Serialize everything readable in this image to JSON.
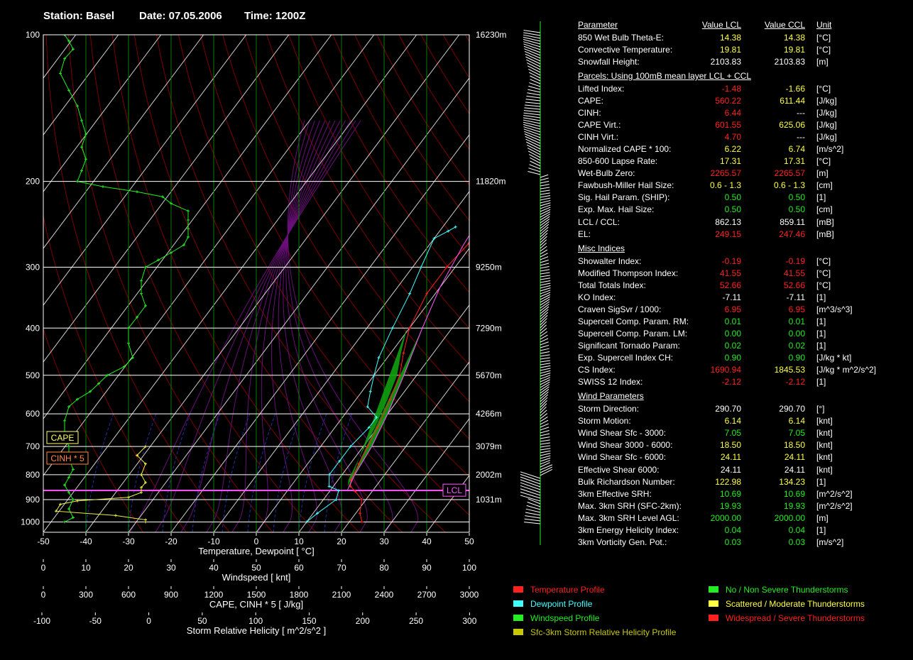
{
  "header": {
    "station": "Station: Basel",
    "date": "Date: 07.05.2006",
    "time": "Time: 1200Z"
  },
  "colors": {
    "temperature": "#ff2020",
    "dewpoint": "#40ffff",
    "windspeed": "#22ee22",
    "srh": "#eeee44",
    "parcel": "#ff55ff",
    "cape_fill": "#10a010",
    "green": "#22ee22",
    "yellow": "#ffff44",
    "red": "#ff2020",
    "white": "#ffffff"
  },
  "chart_data": {
    "type": "line",
    "title": "Skew-T log-P sounding",
    "pressure_levels": [
      100,
      200,
      300,
      400,
      500,
      600,
      700,
      800,
      900,
      1000
    ],
    "height_labels": [
      {
        "p": 100,
        "label": "16230m"
      },
      {
        "p": 200,
        "label": "11820m"
      },
      {
        "p": 300,
        "label": "9250m"
      },
      {
        "p": 400,
        "label": "7290m"
      },
      {
        "p": 500,
        "label": "5670m"
      },
      {
        "p": 600,
        "label": "4266m"
      },
      {
        "p": 700,
        "label": "3079m"
      },
      {
        "p": 800,
        "label": "2002m"
      },
      {
        "p": 900,
        "label": "1031m"
      }
    ],
    "axes": [
      {
        "label": "Temperature, Dewpoint  [ °C]",
        "ticks": [
          "-50",
          "-40",
          "-30",
          "-20",
          "-10",
          "0",
          "10",
          "20",
          "30",
          "40",
          "50"
        ]
      },
      {
        "label": "Windspeed  [ knt]",
        "ticks": [
          "0",
          "10",
          "20",
          "30",
          "40",
          "50",
          "60",
          "70",
          "80",
          "90",
          "100"
        ]
      },
      {
        "label": "CAPE, CINH * 5  [ J/kg]",
        "ticks": [
          "0",
          "300",
          "600",
          "900",
          "1200",
          "1500",
          "1800",
          "2100",
          "2400",
          "2700",
          "3000"
        ]
      },
      {
        "label": "Storm Relative Helicity  [ m^2/s^2 ]",
        "ticks": [
          "-100",
          "-50",
          "0",
          "50",
          "100",
          "150",
          "200",
          "250",
          "300"
        ]
      }
    ],
    "xlim": [
      -50,
      50
    ],
    "plim": [
      100,
      1050
    ],
    "boxes": {
      "cape": "CAPE",
      "cinh": "CINH * 5",
      "lcl": "LCL"
    },
    "lcl_pressure": 862,
    "temperature": [
      [
        -2,
        248
      ],
      [
        -1,
        243
      ],
      [
        0,
        237
      ],
      [
        1,
        230
      ],
      [
        2,
        224
      ],
      [
        4,
        213
      ],
      [
        7,
        205
      ],
      [
        10,
        200
      ],
      [
        13,
        193
      ],
      [
        17,
        185
      ],
      [
        21,
        176
      ],
      [
        25,
        167
      ],
      [
        30,
        158
      ],
      [
        33,
        150
      ],
      [
        36,
        142
      ],
      [
        40,
        134
      ],
      [
        44,
        126
      ],
      [
        48,
        119
      ],
      [
        51,
        113
      ],
      [
        54,
        108
      ],
      [
        57,
        103
      ],
      [
        -1,
        268
      ],
      [
        -2,
        300
      ],
      [
        -2,
        340
      ],
      [
        0,
        400
      ],
      [
        3,
        450
      ],
      [
        6,
        500
      ],
      [
        8,
        560
      ],
      [
        10,
        640
      ],
      [
        11,
        700
      ],
      [
        12,
        760
      ],
      [
        13,
        820
      ],
      [
        14,
        845
      ],
      [
        16,
        865
      ],
      [
        19,
        900
      ],
      [
        21,
        960
      ],
      [
        23,
        1000
      ]
    ],
    "dewpoint": [
      [
        -7,
        248
      ],
      [
        -8,
        253
      ],
      [
        -10,
        262
      ],
      [
        -8,
        300
      ],
      [
        -6,
        340
      ],
      [
        -4,
        400
      ],
      [
        -2,
        460
      ],
      [
        0,
        500
      ],
      [
        2,
        540
      ],
      [
        4,
        580
      ],
      [
        8,
        610
      ],
      [
        8,
        640
      ],
      [
        7,
        700
      ],
      [
        7,
        750
      ],
      [
        7,
        800
      ],
      [
        9,
        845
      ],
      [
        12,
        862
      ],
      [
        13,
        900
      ],
      [
        11,
        960
      ],
      [
        10,
        1000
      ]
    ],
    "dewpoint_upper": [
      [
        -2,
        238
      ],
      [
        0,
        224
      ],
      [
        2,
        212
      ],
      [
        5,
        200
      ]
    ],
    "parcel": [
      [
        14,
        862
      ],
      [
        13,
        800
      ],
      [
        12,
        700
      ],
      [
        10,
        600
      ],
      [
        7,
        500
      ],
      [
        3,
        400
      ],
      [
        0,
        330
      ],
      [
        -2,
        270
      ],
      [
        -3,
        230
      ],
      [
        -3,
        200
      ],
      [
        -3,
        170
      ],
      [
        -2,
        150
      ],
      [
        -1,
        130
      ],
      [
        0,
        115
      ],
      [
        2,
        100
      ]
    ],
    "windspeed": [
      [
        5,
        100
      ],
      [
        6,
        103
      ],
      [
        7,
        107
      ],
      [
        5,
        112
      ],
      [
        4,
        120
      ],
      [
        6,
        130
      ],
      [
        8,
        140
      ],
      [
        9,
        150
      ],
      [
        10,
        160
      ],
      [
        9,
        170
      ],
      [
        10,
        180
      ],
      [
        9,
        190
      ],
      [
        8,
        200
      ],
      [
        14,
        205
      ],
      [
        22,
        210
      ],
      [
        28,
        215
      ],
      [
        30,
        222
      ],
      [
        34,
        230
      ],
      [
        34,
        240
      ],
      [
        34,
        250
      ],
      [
        34,
        260
      ],
      [
        33,
        270
      ],
      [
        30,
        280
      ],
      [
        27,
        290
      ],
      [
        24,
        300
      ],
      [
        23,
        320
      ],
      [
        23,
        340
      ],
      [
        24,
        360
      ],
      [
        22,
        380
      ],
      [
        20,
        400
      ],
      [
        20,
        430
      ],
      [
        21,
        460
      ],
      [
        19,
        480
      ],
      [
        15,
        500
      ],
      [
        13,
        520
      ],
      [
        11,
        540
      ],
      [
        8,
        560
      ],
      [
        6,
        580
      ],
      [
        5,
        620
      ],
      [
        5,
        660
      ],
      [
        6,
        700
      ],
      [
        6,
        740
      ],
      [
        7,
        780
      ],
      [
        6,
        810
      ],
      [
        5,
        840
      ],
      [
        6,
        870
      ],
      [
        7,
        900
      ],
      [
        6,
        940
      ],
      [
        7,
        980
      ],
      [
        5,
        1000
      ]
    ],
    "srh": [
      [
        24,
        700
      ],
      [
        22,
        730
      ],
      [
        24,
        760
      ],
      [
        23,
        800
      ],
      [
        24,
        830
      ],
      [
        23,
        850
      ],
      [
        23,
        870
      ],
      [
        20,
        890
      ],
      [
        8,
        905
      ],
      [
        4,
        920
      ],
      [
        3,
        950
      ],
      [
        17,
        970
      ],
      [
        24,
        990
      ],
      [
        24,
        1000
      ]
    ]
  },
  "params": {
    "rows": [
      {
        "name": "Parameter",
        "v1": "Value LCL",
        "v2": "Value CCL",
        "unit": "Unit",
        "header": true
      },
      {
        "name": "850 Wet Bulb Theta-E:",
        "v1": "14.38",
        "v2": "14.38",
        "unit": "[°C]",
        "c1": "#ffff44",
        "c2": "#ffff44"
      },
      {
        "name": "Convective Temperature:",
        "v1": "19.81",
        "v2": "19.81",
        "unit": "[°C]",
        "c1": "#ffff44",
        "c2": "#ffff44"
      },
      {
        "name": "Snowfall Height:",
        "v1": "2103.83",
        "v2": "2103.83",
        "unit": "[m]",
        "c1": "#ffffff",
        "c2": "#ffffff"
      },
      {
        "name": "Parcels: Using 100mB mean layer LCL + CCL",
        "v1": "",
        "v2": "",
        "unit": "",
        "section": true
      },
      {
        "name": "Lifted Index:",
        "v1": "-1.48",
        "v2": "-1.66",
        "unit": "[°C]",
        "c1": "#ff2020",
        "c2": "#ffff44"
      },
      {
        "name": "CAPE:",
        "v1": "560.22",
        "v2": "611.44",
        "unit": "[J/kg]",
        "c1": "#ff2020",
        "c2": "#ffff44"
      },
      {
        "name": "CINH:",
        "v1": "6.44",
        "v2": "---",
        "unit": "[J/kg]",
        "c1": "#ff2020",
        "c2": "#ffffff"
      },
      {
        "name": "CAPE Virt.:",
        "v1": "601.55",
        "v2": "625.06",
        "unit": "[J/kg]",
        "c1": "#ff2020",
        "c2": "#ffff44"
      },
      {
        "name": "CINH Virt.:",
        "v1": "4.70",
        "v2": "---",
        "unit": "[J/kg]",
        "c1": "#ff2020",
        "c2": "#ffffff"
      },
      {
        "name": "Normalized CAPE * 100:",
        "v1": "6.22",
        "v2": "6.74",
        "unit": "[m/s^2]",
        "c1": "#ffff44",
        "c2": "#ffff44"
      },
      {
        "name": "850-600 Lapse Rate:",
        "v1": "17.31",
        "v2": "17.31",
        "unit": "[°C]",
        "c1": "#ffff44",
        "c2": "#ffff44"
      },
      {
        "name": "Wet-Bulb Zero:",
        "v1": "2265.57",
        "v2": "2265.57",
        "unit": "[m]",
        "c1": "#ff2020",
        "c2": "#ff2020"
      },
      {
        "name": "Fawbush-Miller Hail Size:",
        "v1": "0.6 - 1.3",
        "v2": "0.6 - 1.3",
        "unit": "[cm]",
        "c1": "#ffff44",
        "c2": "#ffff44"
      },
      {
        "name": "Sig. Hail Param. (SHIP):",
        "v1": "0.50",
        "v2": "0.50",
        "unit": "[1]",
        "c1": "#22ee22",
        "c2": "#22ee22"
      },
      {
        "name": "Exp. Max. Hail Size:",
        "v1": "0.50",
        "v2": "0.50",
        "unit": "[cm]",
        "c1": "#22ee22",
        "c2": "#22ee22"
      },
      {
        "name": "LCL / CCL:",
        "v1": "862.13",
        "v2": "859.11",
        "unit": "[mB]",
        "c1": "#ffffff",
        "c2": "#ffffff"
      },
      {
        "name": "EL:",
        "v1": "249.15",
        "v2": "247.46",
        "unit": "[mB]",
        "c1": "#ff2020",
        "c2": "#ff2020"
      },
      {
        "name": "Misc Indices",
        "v1": "",
        "v2": "",
        "unit": "",
        "section": true
      },
      {
        "name": "Showalter Index:",
        "v1": "-0.19",
        "v2": "-0.19",
        "unit": "[°C]",
        "c1": "#ff2020",
        "c2": "#ff2020"
      },
      {
        "name": "Modified Thompson Index:",
        "v1": "41.55",
        "v2": "41.55",
        "unit": "[°C]",
        "c1": "#ff2020",
        "c2": "#ff2020"
      },
      {
        "name": "Total Totals Index:",
        "v1": "52.66",
        "v2": "52.66",
        "unit": "[°C]",
        "c1": "#ff2020",
        "c2": "#ff2020"
      },
      {
        "name": "KO Index:",
        "v1": "-7.11",
        "v2": "-7.11",
        "unit": "[1]",
        "c1": "#ffffff",
        "c2": "#ffffff"
      },
      {
        "name": "Craven SigSvr / 1000:",
        "v1": "6.95",
        "v2": "6.95",
        "unit": "[m^3/s^3]",
        "c1": "#ff2020",
        "c2": "#ff2020"
      },
      {
        "name": "Supercell Comp. Param. RM:",
        "v1": "0.01",
        "v2": "0.01",
        "unit": "[1]",
        "c1": "#22ee22",
        "c2": "#22ee22"
      },
      {
        "name": "Supercell Comp. Param. LM:",
        "v1": "0.00",
        "v2": "0.00",
        "unit": "[1]",
        "c1": "#22ee22",
        "c2": "#22ee22"
      },
      {
        "name": "Significant Tornado Param:",
        "v1": "0.02",
        "v2": "0.02",
        "unit": "[1]",
        "c1": "#22ee22",
        "c2": "#22ee22"
      },
      {
        "name": "Exp. Supercell Index CH:",
        "v1": "0.90",
        "v2": "0.90",
        "unit": "[J/kg * kt]",
        "c1": "#22ee22",
        "c2": "#22ee22"
      },
      {
        "name": "CS Index:",
        "v1": "1690.94",
        "v2": "1845.53",
        "unit": "[J/kg * m^2/s^2]",
        "c1": "#ff2020",
        "c2": "#ffff44"
      },
      {
        "name": "SWISS 12 Index:",
        "v1": "-2.12",
        "v2": "-2.12",
        "unit": "[1]",
        "c1": "#ff2020",
        "c2": "#ff2020"
      },
      {
        "name": "Wind Parameters",
        "v1": "",
        "v2": "",
        "unit": "",
        "section": true
      },
      {
        "name": "Storm Direction:",
        "v1": "290.70",
        "v2": "290.70",
        "unit": "[°]",
        "c1": "#ffffff",
        "c2": "#ffffff"
      },
      {
        "name": "Storm Motion:",
        "v1": "6.14",
        "v2": "6.14",
        "unit": "[knt]",
        "c1": "#ffff44",
        "c2": "#ffff44"
      },
      {
        "name": "Wind Shear Sfc - 3000:",
        "v1": "7.05",
        "v2": "7.05",
        "unit": "[knt]",
        "c1": "#22ee22",
        "c2": "#22ee22"
      },
      {
        "name": "Wind Shear 3000 - 6000:",
        "v1": "18.50",
        "v2": "18.50",
        "unit": "[knt]",
        "c1": "#ffff44",
        "c2": "#ffff44"
      },
      {
        "name": "Wind Shear Sfc - 6000:",
        "v1": "24.11",
        "v2": "24.11",
        "unit": "[knt]",
        "c1": "#ffff44",
        "c2": "#ffff44"
      },
      {
        "name": "Effective Shear 6000:",
        "v1": "24.11",
        "v2": "24.11",
        "unit": "[knt]",
        "c1": "#ffffff",
        "c2": "#ffffff"
      },
      {
        "name": "Bulk Richardson Number:",
        "v1": "122.98",
        "v2": "134.23",
        "unit": "[1]",
        "c1": "#ffff44",
        "c2": "#ffff44"
      },
      {
        "name": "3km Effective SRH:",
        "v1": "10.69",
        "v2": "10.69",
        "unit": "[m^2/s^2]",
        "c1": "#22ee22",
        "c2": "#22ee22"
      },
      {
        "name": "Max. 3km SRH (SFC-2km):",
        "v1": "19.93",
        "v2": "19.93",
        "unit": "[m^2/s^2]",
        "c1": "#22ee22",
        "c2": "#22ee22"
      },
      {
        "name": "Max. 3km SRH Level AGL:",
        "v1": "2000.00",
        "v2": "2000.00",
        "unit": "[m]",
        "c1": "#22ee22",
        "c2": "#22ee22"
      },
      {
        "name": "3km Energy Helicity Index:",
        "v1": "0.04",
        "v2": "0.04",
        "unit": "[1]",
        "c1": "#22ee22",
        "c2": "#22ee22"
      },
      {
        "name": "3km Vorticity Gen. Pot.:",
        "v1": "0.03",
        "v2": "0.03",
        "unit": "[m/s^2]",
        "c1": "#22ee22",
        "c2": "#22ee22"
      }
    ]
  },
  "legend": {
    "profiles": [
      {
        "label": "Temperature Profile",
        "color": "#ff2020"
      },
      {
        "label": "Dewpoint Profile",
        "color": "#40ffff"
      },
      {
        "label": "Windspeed Profile",
        "color": "#22ee22"
      },
      {
        "label": "Sfc-3km Storm Relative Helicity Profile",
        "color": "#c8c800"
      }
    ],
    "thunder": [
      {
        "label": "No / Non Severe Thunderstorms",
        "color": "#22ee22"
      },
      {
        "label": "Scattered / Moderate Thunderstorms",
        "color": "#ffff44"
      },
      {
        "label": "Widespread / Severe Thunderstorms",
        "color": "#ff2020"
      }
    ]
  }
}
